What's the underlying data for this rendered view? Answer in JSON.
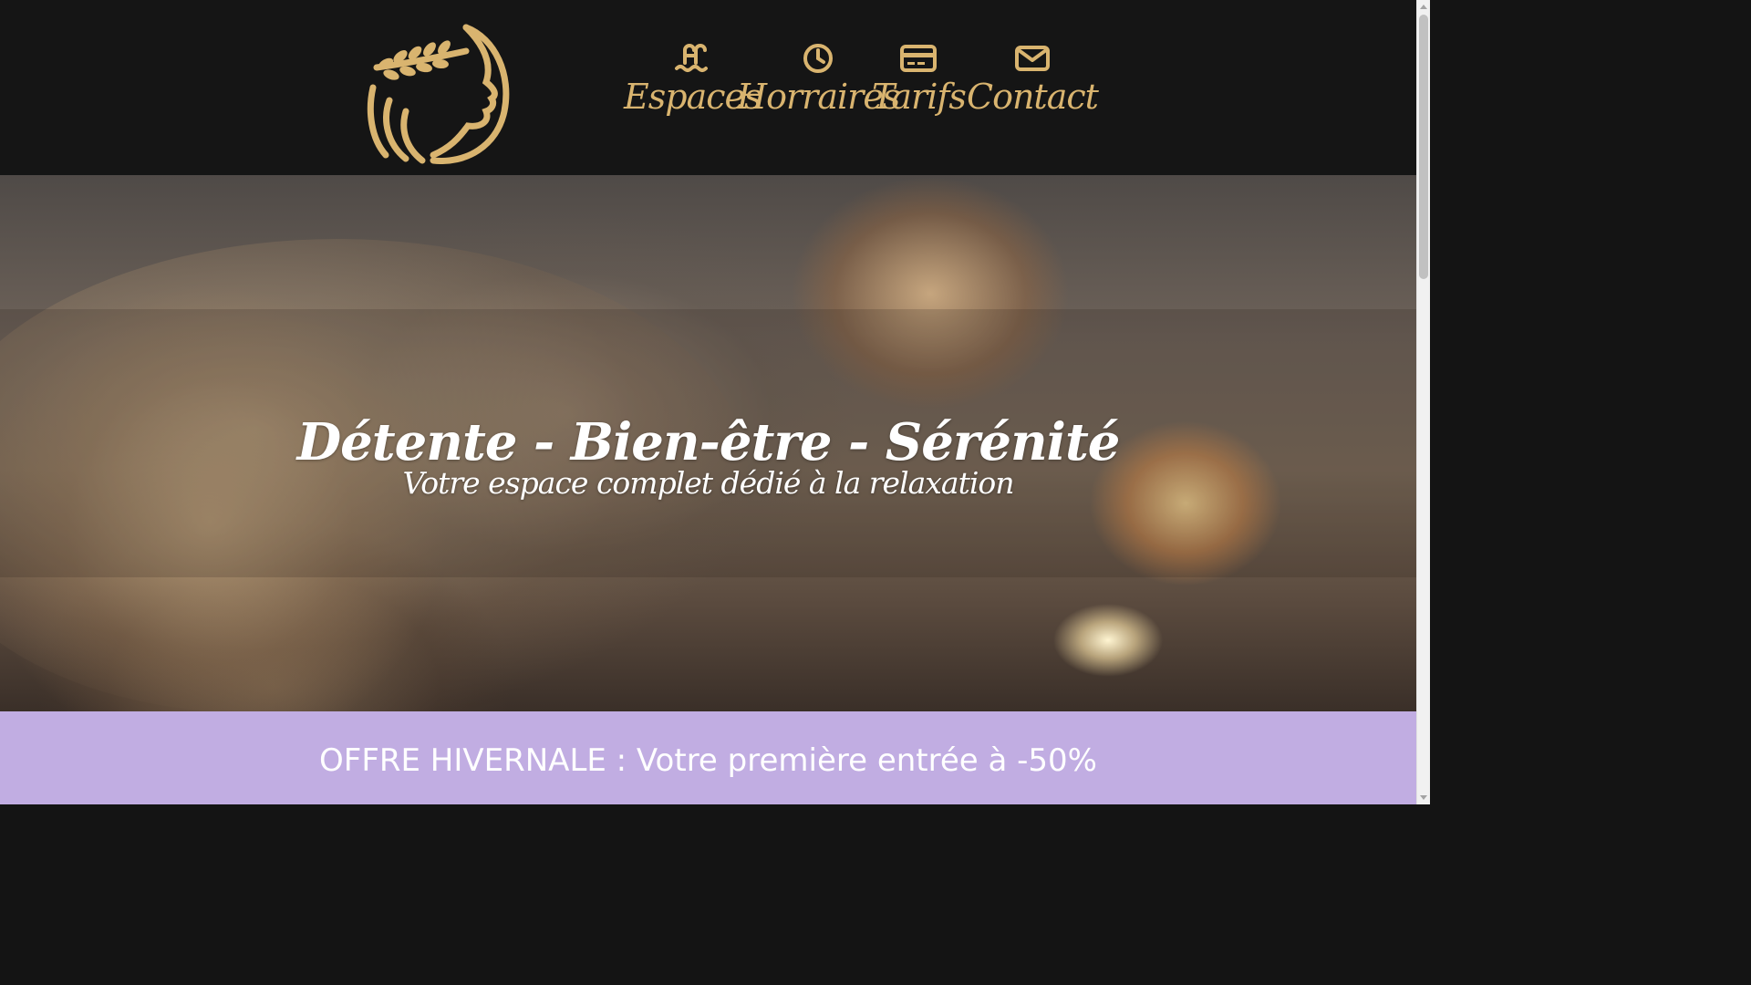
{
  "colors": {
    "header_bg": "#151515",
    "gold": "#d9b46f",
    "offer_bg": "#c1ade2",
    "white": "#ffffff"
  },
  "header": {
    "logo_icon": "woman-profile-laurel-logo",
    "nav": [
      {
        "label": "Espaces",
        "icon": "pool-ladder-icon"
      },
      {
        "label": "Horraires",
        "icon": "clock-icon"
      },
      {
        "label": "Tarifs",
        "icon": "credit-card-icon"
      },
      {
        "label": "Contact",
        "icon": "envelope-icon"
      }
    ]
  },
  "hero": {
    "title": "Détente - Bien-être - Sérénité",
    "subtitle": "Votre espace complet dédié à la relaxation"
  },
  "offer": {
    "text": "OFFRE HIVERNALE : Votre première entrée à -50%"
  }
}
